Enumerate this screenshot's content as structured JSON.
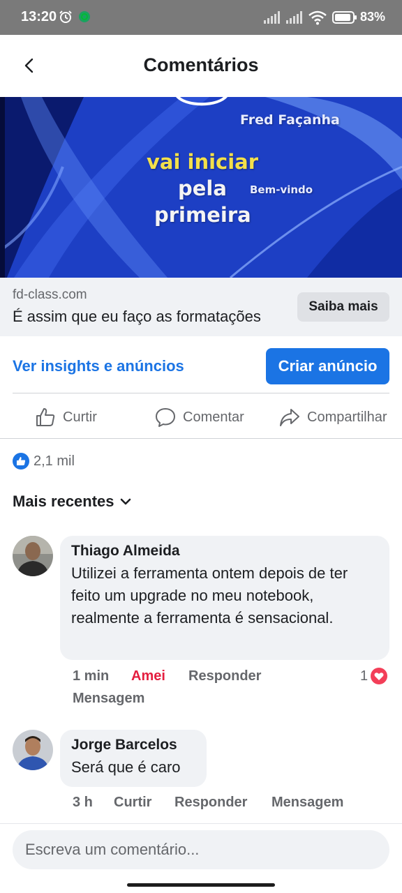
{
  "status_bar": {
    "time": "13:20",
    "battery": "83%",
    "icons": [
      "alarm-icon",
      "vpn-icon",
      "signal-icon",
      "signal-icon",
      "wifi-icon",
      "battery-icon"
    ]
  },
  "header": {
    "title": "Comentários",
    "back_icon": "chevron-left-icon"
  },
  "video": {
    "name_text": "Fred Façanha",
    "line1": "vai iniciar",
    "line2": "pela",
    "line3": "primeira",
    "small_text": "Bem-vindo"
  },
  "ad": {
    "domain": "fd-class.com",
    "headline": "É assim que eu faço as formatações",
    "cta": "Saiba mais"
  },
  "promo": {
    "insights_link": "Ver insights e anúncios",
    "create_ad": "Criar anúncio"
  },
  "actions": {
    "like": "Curtir",
    "comment": "Comentar",
    "share": "Compartilhar"
  },
  "reactions": {
    "count": "2,1 mil"
  },
  "sort": {
    "label": "Mais recentes"
  },
  "comments": [
    {
      "author": "Thiago Almeida",
      "text": "Utilizei a ferramenta ontem depois de ter feito um upgrade no meu notebook, realmente a ferramenta é sensacional.",
      "time": "1 min",
      "reaction_label": "Amei",
      "reply": "Responder",
      "message": "Mensagem",
      "reaction_count": "1"
    },
    {
      "author": "Jorge Barcelos",
      "text": "Será que é caro",
      "time": "3 h",
      "reaction_label": "Curtir",
      "reply": "Responder",
      "message": "Mensagem"
    }
  ],
  "compose": {
    "placeholder": "Escreva um comentário..."
  },
  "colors": {
    "accent": "#1b74e4",
    "love": "#e41e3f",
    "secondary_text": "#65676b",
    "bubble": "#f0f2f5",
    "status_bar": "#7a7a7a"
  }
}
